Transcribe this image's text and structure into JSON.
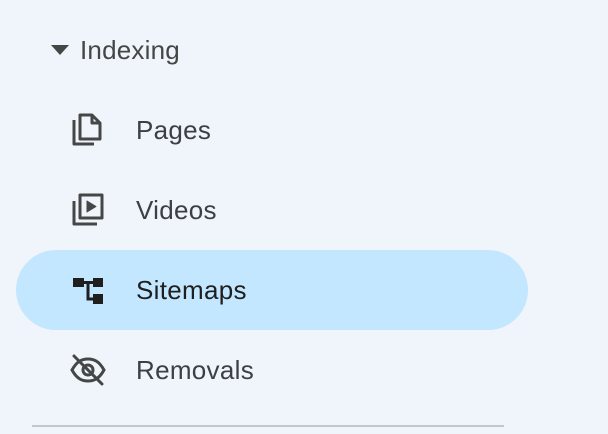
{
  "section": {
    "label": "Indexing",
    "expanded": true,
    "icon": "arrow-drop-down-icon"
  },
  "items": [
    {
      "label": "Pages",
      "icon": "pages-icon",
      "active": false
    },
    {
      "label": "Videos",
      "icon": "video-library-icon",
      "active": false
    },
    {
      "label": "Sitemaps",
      "icon": "sitemap-icon",
      "active": true
    },
    {
      "label": "Removals",
      "icon": "visibility-off-icon",
      "active": false
    }
  ],
  "colors": {
    "background": "#f0f4fb",
    "active_background": "#c2e7ff",
    "text": "#3c4043",
    "icon": "#444746"
  }
}
